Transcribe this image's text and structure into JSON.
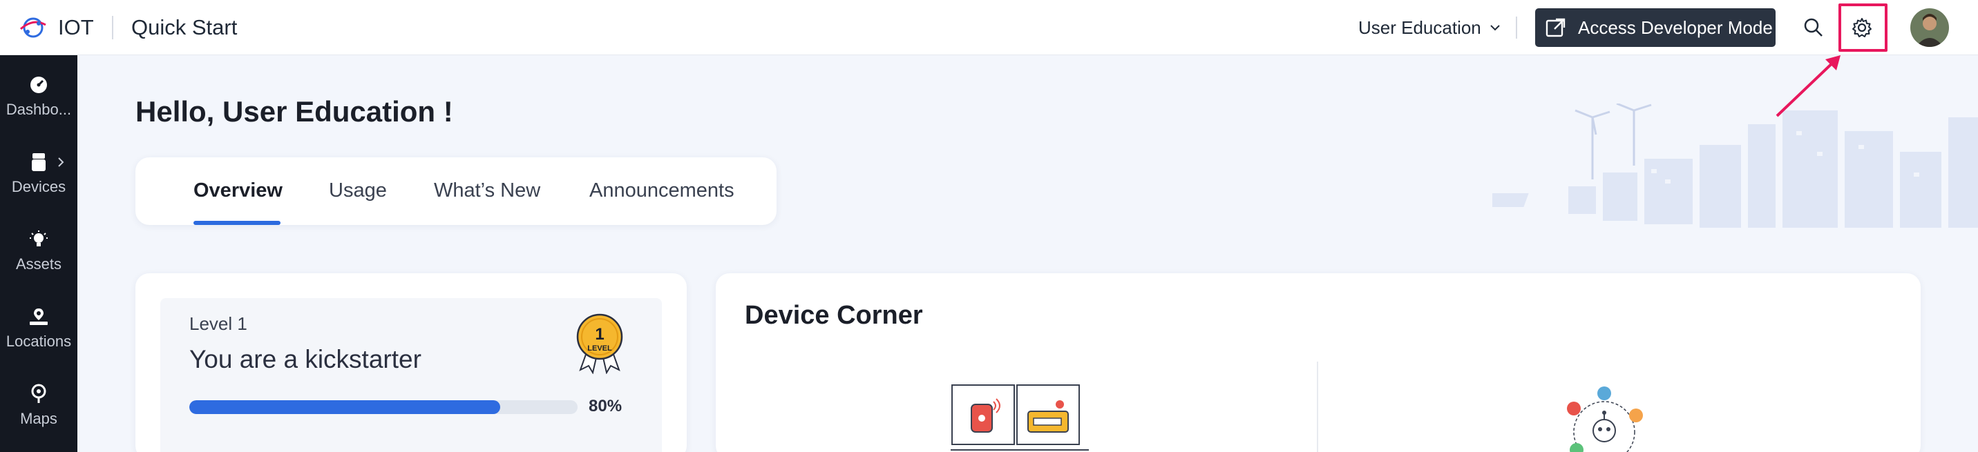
{
  "header": {
    "brand": "IOT",
    "page_title": "Quick Start",
    "org_selector": "User Education",
    "developer_button": "Access Developer Mode",
    "icons": [
      "search-icon",
      "gear-icon"
    ]
  },
  "sidebar": {
    "items": [
      {
        "label": "Dashbo...",
        "icon": "dashboard-icon"
      },
      {
        "label": "Devices",
        "icon": "device-icon",
        "has_submenu": true
      },
      {
        "label": "Assets",
        "icon": "asset-icon"
      },
      {
        "label": "Locations",
        "icon": "location-icon"
      },
      {
        "label": "Maps",
        "icon": "map-pin-icon"
      }
    ]
  },
  "main": {
    "greeting": "Hello, User Education !",
    "tabs": [
      {
        "label": "Overview",
        "active": true
      },
      {
        "label": "Usage",
        "active": false
      },
      {
        "label": "What’s New",
        "active": false
      },
      {
        "label": "Announcements",
        "active": false
      }
    ]
  },
  "level_card": {
    "level_label": "Level 1",
    "status": "You are a kickstarter",
    "progress_percent": 80,
    "progress_text": "80%",
    "badge_number": "1",
    "badge_text": "LEVEL"
  },
  "device_corner": {
    "title": "Device Corner"
  },
  "colors": {
    "accent": "#2e6be0",
    "sidebar_bg": "#141821",
    "button_dark": "#2a3341",
    "highlight": "#e8175d",
    "badge_gold": "#f5b72e"
  }
}
